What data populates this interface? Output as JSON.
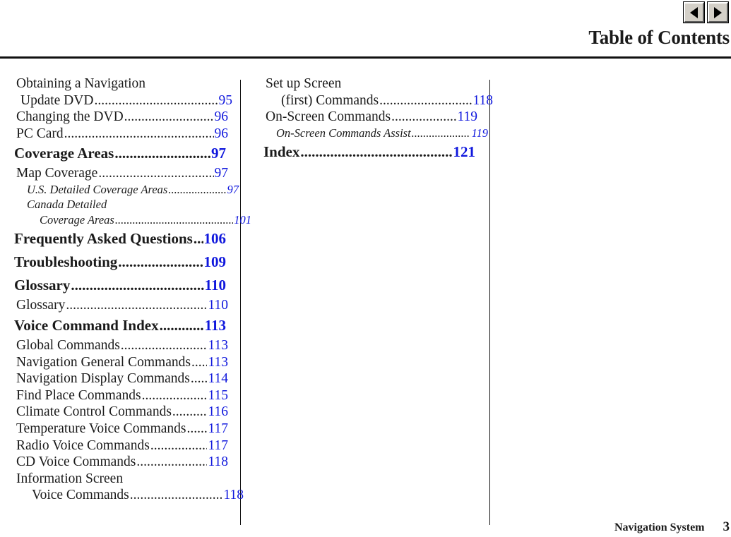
{
  "header": {
    "title": "Table of Contents",
    "prev_button_icon": "triangle-left-icon",
    "next_button_icon": "triangle-right-icon"
  },
  "footer": {
    "document_title": "Navigation System",
    "page_number": "3"
  },
  "colors": {
    "page_number": "#1018dd",
    "text": "#1a1a1a",
    "rule": "#111111"
  },
  "columns": {
    "left": [
      {
        "type": "plain",
        "level": 1,
        "label": "Obtaining a Navigation"
      },
      {
        "type": "entry",
        "level": 1,
        "cont": 1,
        "label": "Update DVD",
        "page": "95"
      },
      {
        "type": "entry",
        "level": 1,
        "label": "Changing the DVD",
        "page": "96"
      },
      {
        "type": "entry",
        "level": 1,
        "label": "PC Card",
        "page": "96"
      },
      {
        "type": "entry",
        "level": 0,
        "label": "Coverage Areas",
        "page": "97"
      },
      {
        "type": "entry",
        "level": 1,
        "label": "Map Coverage",
        "page": "97"
      },
      {
        "type": "entry",
        "level": 2,
        "label": "U.S. Detailed Coverage Areas",
        "page": "97"
      },
      {
        "type": "plain",
        "level": 2,
        "label": "Canada Detailed"
      },
      {
        "type": "entry",
        "level": 2,
        "cont": 1,
        "label": "Coverage Areas",
        "page": "101"
      },
      {
        "type": "entry",
        "level": 0,
        "label": "Frequently Asked Questions",
        "page": "106"
      },
      {
        "type": "entry",
        "level": 0,
        "label": "Troubleshooting",
        "page": "109"
      },
      {
        "type": "entry",
        "level": 0,
        "label": "Glossary",
        "page": "110"
      },
      {
        "type": "entry",
        "level": 1,
        "label": "Glossary",
        "page": "110"
      },
      {
        "type": "entry",
        "level": 0,
        "label": "Voice Command Index",
        "page": "113"
      },
      {
        "type": "entry",
        "level": 1,
        "label": "Global Commands",
        "page": "113"
      },
      {
        "type": "entry",
        "level": 1,
        "label": "Navigation General Commands",
        "page": "113"
      },
      {
        "type": "entry",
        "level": 1,
        "label": "Navigation Display Commands",
        "page": "114"
      },
      {
        "type": "entry",
        "level": 1,
        "label": "Find Place Commands",
        "page": "115"
      },
      {
        "type": "entry",
        "level": 1,
        "label": "Climate Control Commands",
        "page": "116"
      },
      {
        "type": "entry",
        "level": 1,
        "label": "Temperature Voice Commands",
        "page": "117"
      },
      {
        "type": "entry",
        "level": 1,
        "label": "Radio Voice Commands",
        "page": "117"
      },
      {
        "type": "entry",
        "level": 1,
        "label": "CD Voice Commands",
        "page": "118"
      },
      {
        "type": "plain",
        "level": 1,
        "label": "Information Screen"
      },
      {
        "type": "entry",
        "level": 1,
        "cont": 2,
        "label": "Voice Commands",
        "page": "118"
      }
    ],
    "right": [
      {
        "type": "plain",
        "level": 1,
        "label": "Set up Screen"
      },
      {
        "type": "entry",
        "level": 1,
        "cont": 2,
        "label": "(first) Commands",
        "page": "118"
      },
      {
        "type": "entry",
        "level": 1,
        "label": "On-Screen Commands",
        "page": "119"
      },
      {
        "type": "entry",
        "level": 2,
        "label": "On-Screen Commands Assist",
        "page": "119"
      },
      {
        "type": "entry",
        "level": 0,
        "label": "Index",
        "page": "121"
      }
    ]
  }
}
